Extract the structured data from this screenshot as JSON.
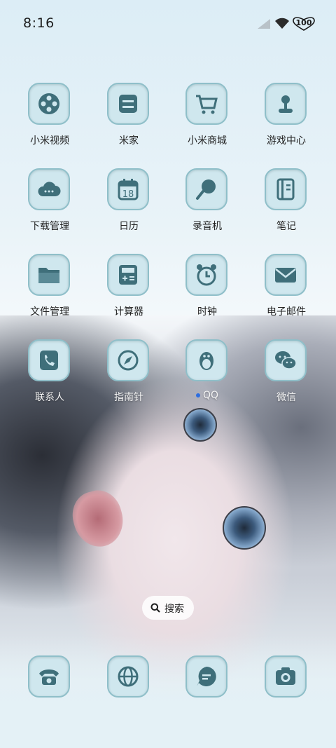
{
  "status_bar": {
    "time": "8:16",
    "battery_level": "100",
    "signal_icon": "signal-icon",
    "wifi_icon": "wifi-icon",
    "battery_icon": "battery-icon"
  },
  "apps": [
    {
      "label": "小米视频",
      "icon": "video-icon"
    },
    {
      "label": "米家",
      "icon": "home-devices-icon"
    },
    {
      "label": "小米商城",
      "icon": "cart-icon"
    },
    {
      "label": "游戏中心",
      "icon": "game-icon"
    },
    {
      "label": "下载管理",
      "icon": "download-cloud-icon"
    },
    {
      "label": "日历",
      "icon": "calendar-icon",
      "date": "18"
    },
    {
      "label": "录音机",
      "icon": "microphone-icon"
    },
    {
      "label": "笔记",
      "icon": "notebook-icon"
    },
    {
      "label": "文件管理",
      "icon": "folder-icon"
    },
    {
      "label": "计算器",
      "icon": "calculator-icon"
    },
    {
      "label": "时钟",
      "icon": "clock-icon"
    },
    {
      "label": "电子邮件",
      "icon": "mail-icon"
    },
    {
      "label": "联系人",
      "icon": "contacts-icon"
    },
    {
      "label": "指南针",
      "icon": "compass-icon"
    },
    {
      "label": "QQ",
      "icon": "qq-penguin-icon"
    },
    {
      "label": "微信",
      "icon": "wechat-icon"
    }
  ],
  "search": {
    "label": "搜索",
    "icon": "search-icon"
  },
  "dock": [
    {
      "name": "phone",
      "icon": "phone-icon"
    },
    {
      "name": "browser",
      "icon": "globe-icon"
    },
    {
      "name": "messages",
      "icon": "message-icon"
    },
    {
      "name": "camera",
      "icon": "camera-icon"
    }
  ],
  "colors": {
    "tile": "#cfe7ee",
    "tile_border": "#8fbfc9",
    "glyph": "#3f6f7a"
  }
}
